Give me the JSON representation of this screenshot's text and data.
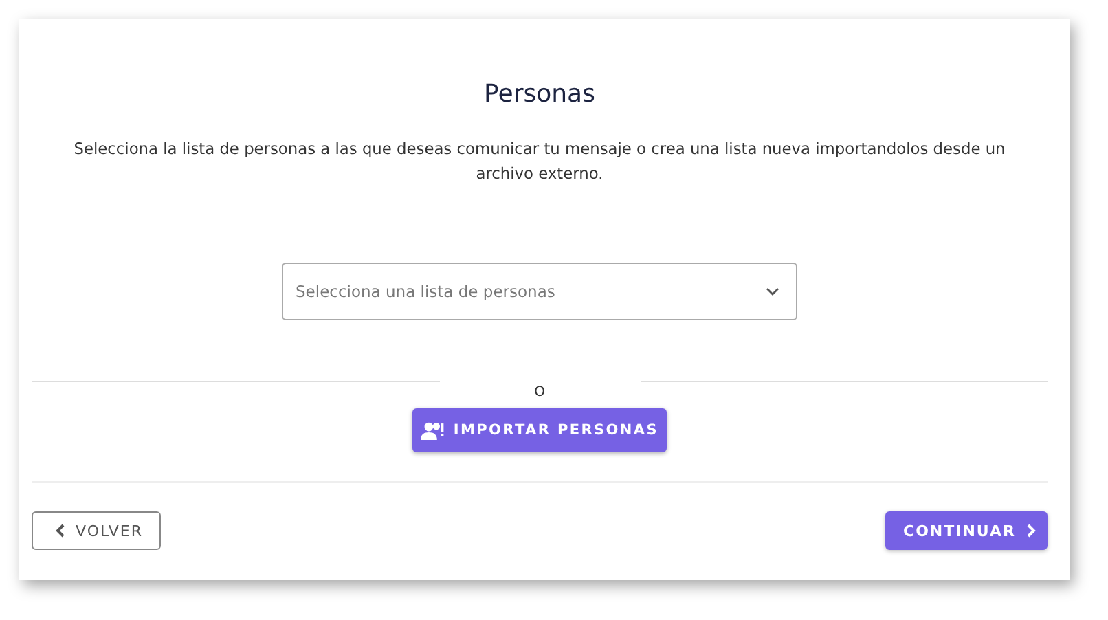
{
  "title": "Personas",
  "description": "Selecciona la lista de personas a las que deseas comunicar tu mensaje o crea una lista nueva importandolos desde un archivo externo.",
  "select": {
    "placeholder": "Selecciona una lista de personas"
  },
  "separator": "O",
  "import_button": "IMPORTAR PERSONAS",
  "buttons": [
    {
      "label": "VOLVER",
      "kind": "back"
    },
    {
      "label": "CONTINUAR",
      "kind": "next"
    }
  ]
}
